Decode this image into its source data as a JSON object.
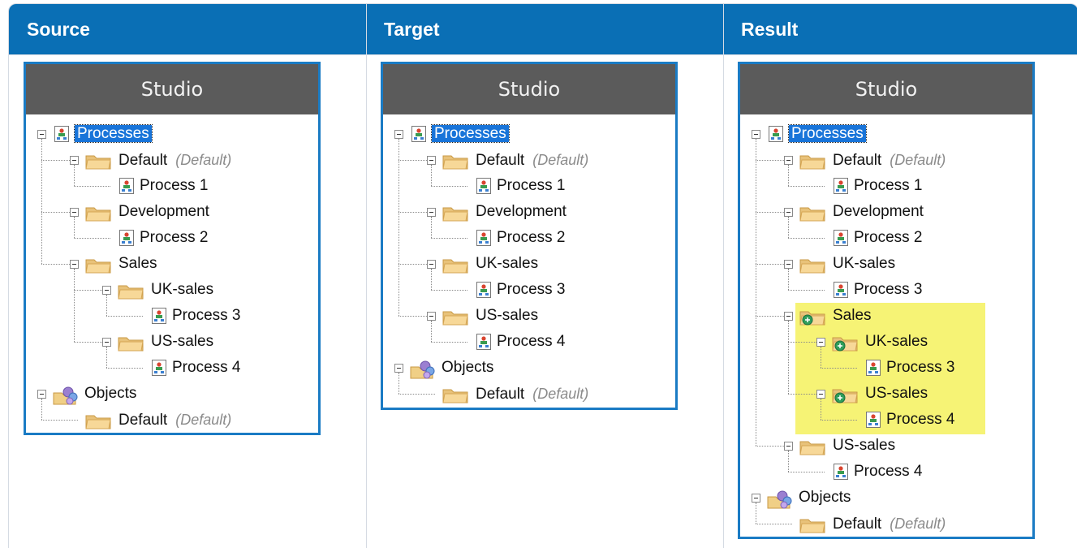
{
  "columns": [
    "Source",
    "Target",
    "Result"
  ],
  "studio_title": "Studio",
  "labels": {
    "processes": "Processes",
    "objects": "Objects",
    "default": "Default",
    "default_tag": "(Default)",
    "development": "Development",
    "sales": "Sales",
    "uk_sales": "UK-sales",
    "us_sales": "US-sales",
    "process_1": "Process 1",
    "process_2": "Process 2",
    "process_3": "Process 3",
    "process_4": "Process 4"
  },
  "colors": {
    "header_bg": "#0a6fb5",
    "panel_border": "#1a7bc4",
    "studio_bar": "#5b5b5b",
    "selection": "#1874d9",
    "highlight": "#f6f375"
  },
  "icons": {
    "process": "process-icon",
    "folder": "folder-icon",
    "objects": "objects-icon",
    "merge": "merge-badge-icon"
  }
}
